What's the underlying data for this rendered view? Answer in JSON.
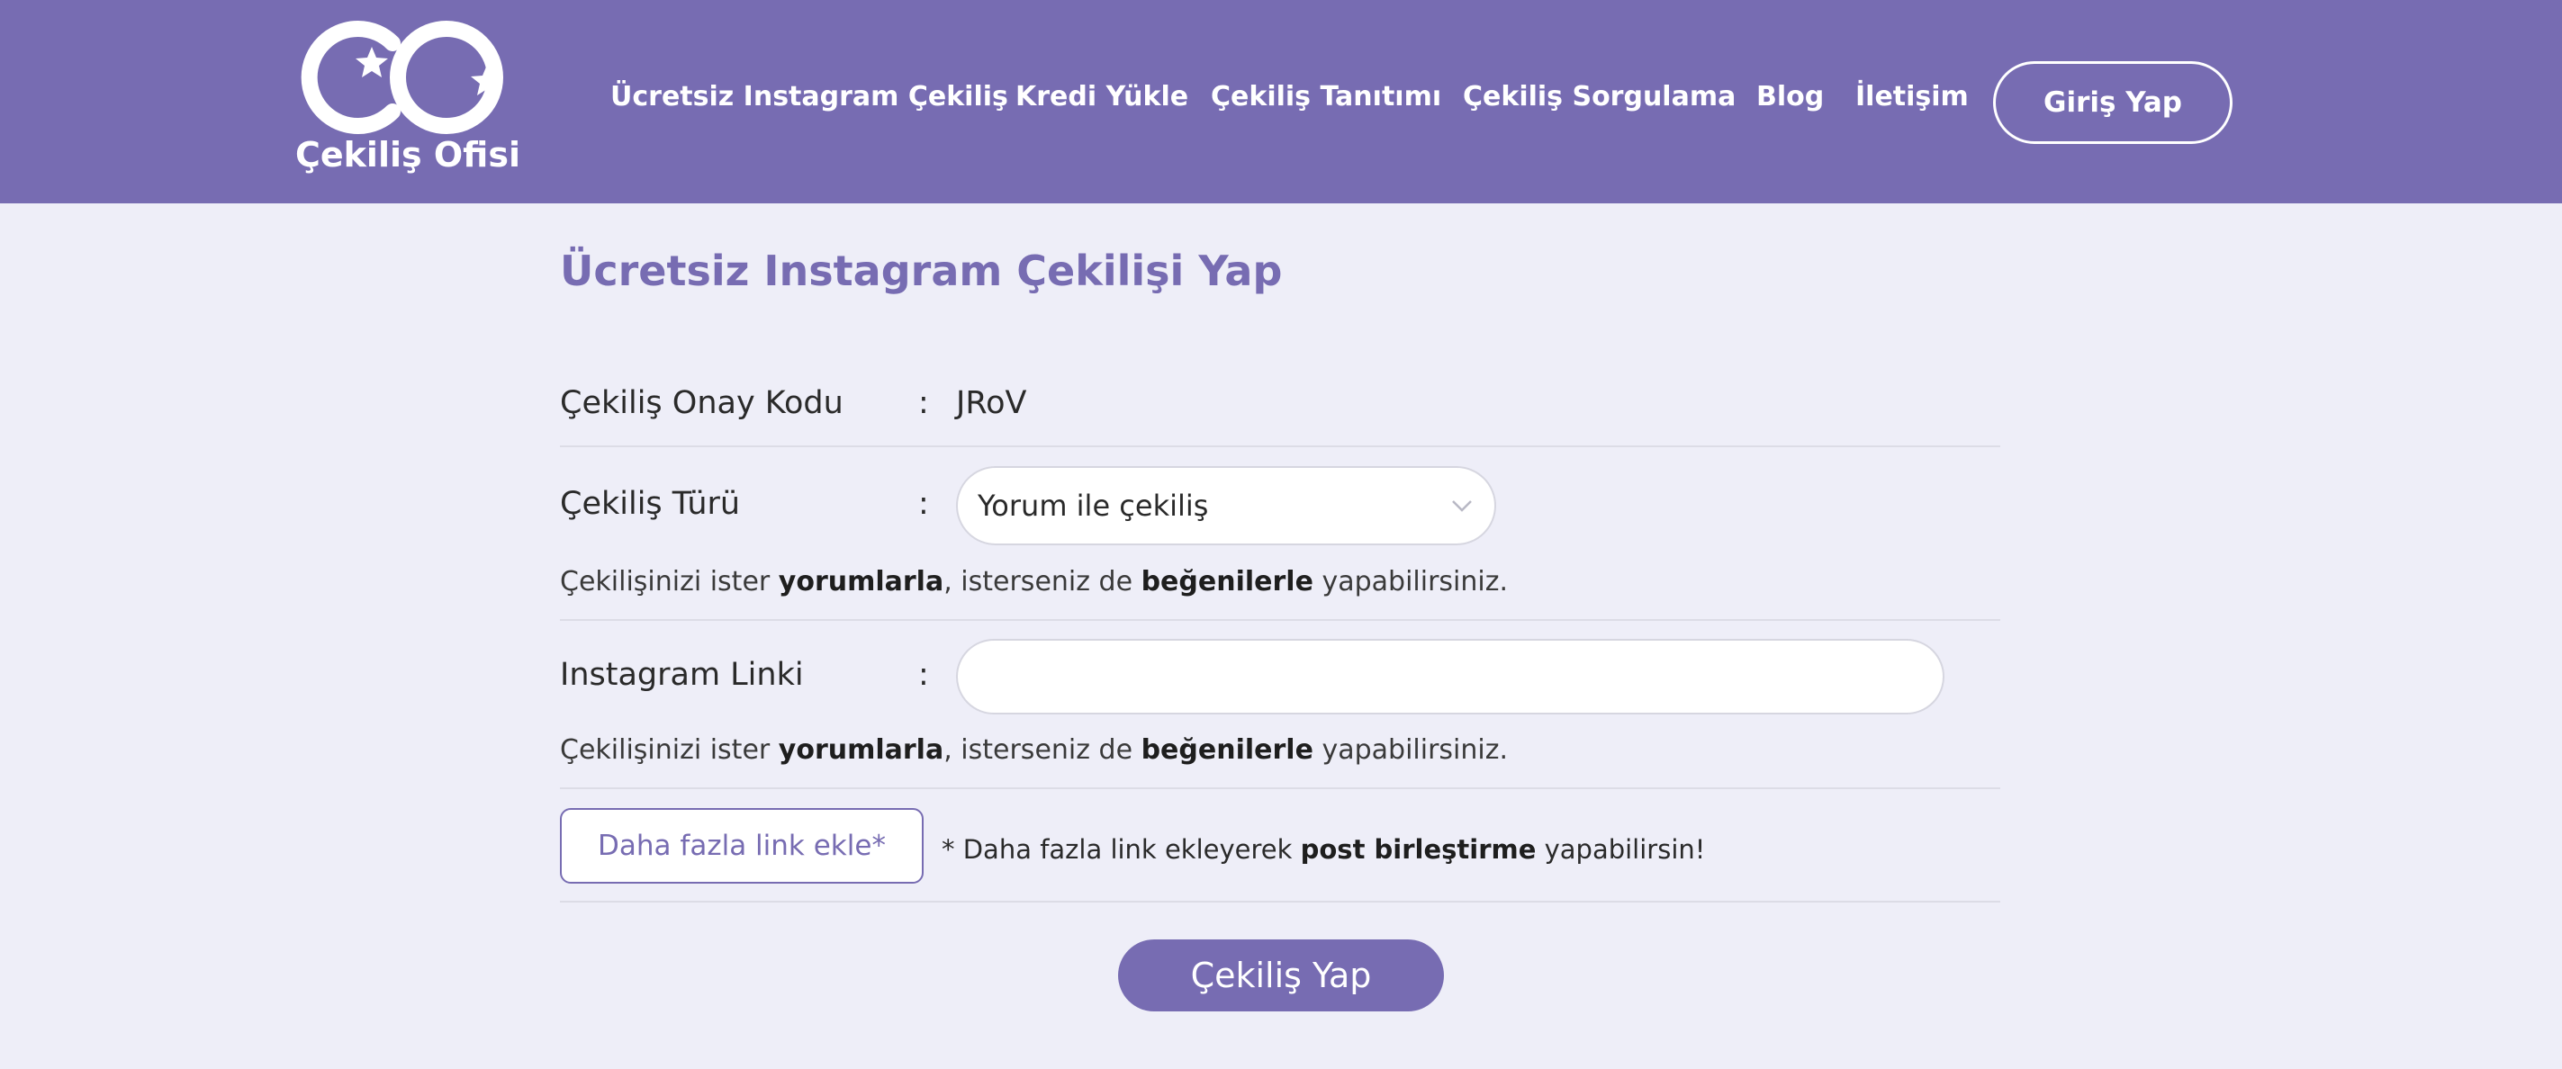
{
  "header": {
    "logo_text": "Çekiliş Ofisi",
    "nav": [
      {
        "label": "Ücretsiz Instagram Çekiliş"
      },
      {
        "label": "Kredi Yükle"
      },
      {
        "label": "Çekiliş Tanıtımı"
      },
      {
        "label": "Çekiliş Sorgulama"
      },
      {
        "label": "Blog"
      },
      {
        "label": "İletişim"
      }
    ],
    "login_label": "Giriş Yap"
  },
  "main": {
    "title": "Ücretsiz Instagram Çekilişi Yap",
    "approval": {
      "label": "Çekiliş Onay Kodu",
      "colon": ":",
      "value": "JRoV"
    },
    "type": {
      "label": "Çekiliş Türü",
      "colon": ":",
      "selected": "Yorum ile çekiliş"
    },
    "help_prefix": "Çekilişinizi ister ",
    "help_bold1": "yorumlarla",
    "help_mid": ", isterseniz de ",
    "help_bold2": "beğenilerle",
    "help_suffix": " yapabilirsiniz.",
    "link": {
      "label": "Instagram Linki",
      "colon": ":",
      "value": "",
      "placeholder": ""
    },
    "more_button": "Daha fazla link ekle*",
    "more_note_prefix": "* Daha fazla link ekleyerek ",
    "more_note_bold": "post birleştirme",
    "more_note_suffix": " yapabilirsin!",
    "submit_label": "Çekiliş Yap"
  },
  "colors": {
    "brand": "#776cb2",
    "background": "#eeeef8"
  },
  "icons": [
    "logo-icon",
    "chevron-down-icon"
  ]
}
